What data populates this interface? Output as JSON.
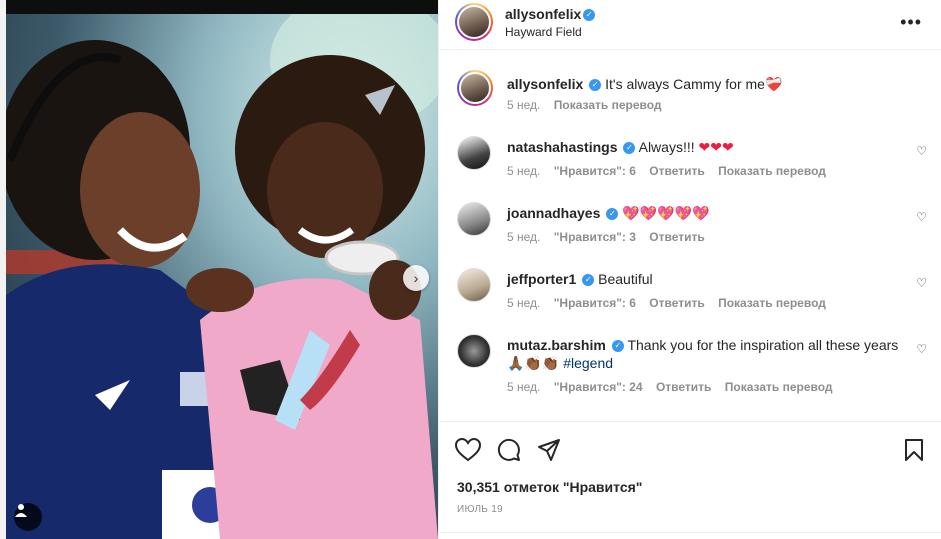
{
  "post": {
    "author": "allysonfelix",
    "location": "Hayward Field",
    "caption": "It's always Cammy for me",
    "caption_emoji": "❤️‍🩹",
    "caption_time": "5 нед.",
    "caption_translate": "Показать перевод"
  },
  "comments": [
    {
      "user": "natashahastings",
      "text": "Always!!!",
      "emoji": "❤❤❤",
      "time": "5 нед.",
      "likes": "\"Нравится\": 6",
      "reply": "Ответить",
      "translate": "Показать перевод"
    },
    {
      "user": "joannadhayes",
      "text": "",
      "emoji": "💖💖💖💖💖",
      "time": "5 нед.",
      "likes": "\"Нравится\": 3",
      "reply": "Ответить",
      "translate": ""
    },
    {
      "user": "jeffporter1",
      "text": "Beautiful",
      "emoji": "",
      "time": "5 нед.",
      "likes": "\"Нравится\": 6",
      "reply": "Ответить",
      "translate": "Показать перевод"
    },
    {
      "user": "mutaz.barshim",
      "text": "Thank you for the inspiration all these years",
      "emoji": "🙏🏾👏🏾👏🏾",
      "hashtag": "#legend",
      "time": "5 нед.",
      "likes": "\"Нравится\": 24",
      "reply": "Ответить",
      "translate": "Показать перевод"
    }
  ],
  "footer": {
    "likes": "30,351 отметок \"Нравится\"",
    "date": "ИЮЛЬ 19"
  },
  "icons": {
    "verified": "verified-badge-icon",
    "more": "more-options-icon",
    "like": "heart-icon",
    "comment": "comment-icon",
    "share": "share-icon",
    "save": "bookmark-icon",
    "next": "chevron-right-icon",
    "tag": "user-tag-icon"
  },
  "colors": {
    "verified": "#3897f0",
    "muted": "#8e8e8e",
    "text": "#262626",
    "hashtag": "#00376b"
  }
}
